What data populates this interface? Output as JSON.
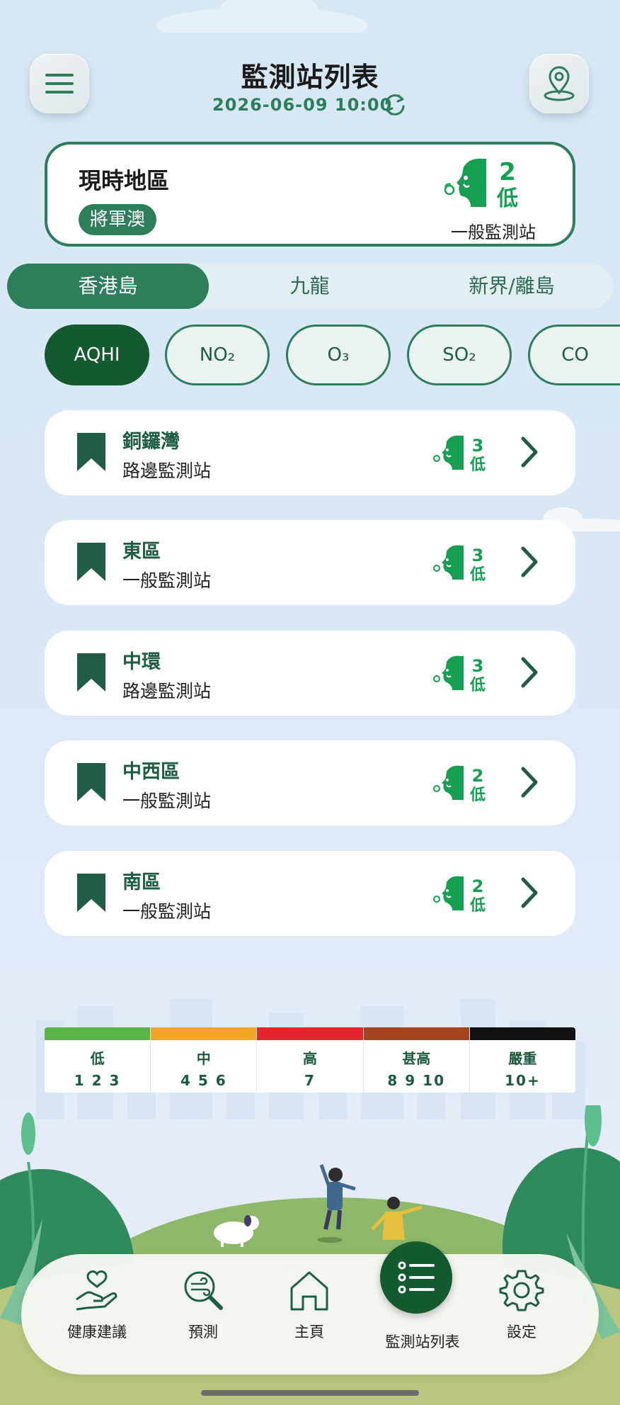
{
  "header": {
    "title": "監測站列表",
    "datetime": "2026-06-09 10:00"
  },
  "current_area": {
    "title": "現時地區",
    "district": "將軍澳",
    "aqhi_value": "2",
    "aqhi_level": "低",
    "station_type": "一般監測站"
  },
  "region_tabs": [
    {
      "label": "香港島",
      "active": true
    },
    {
      "label": "九龍",
      "active": false
    },
    {
      "label": "新界/離島",
      "active": false
    }
  ],
  "pollutant_chips": [
    {
      "label": "AQHI",
      "active": true
    },
    {
      "label": "NO₂",
      "active": false
    },
    {
      "label": "O₃",
      "active": false
    },
    {
      "label": "SO₂",
      "active": false
    },
    {
      "label": "CO",
      "active": false
    }
  ],
  "stations": [
    {
      "name": "銅鑼灣",
      "type": "路邊監測站",
      "aqhi": "3",
      "level": "低"
    },
    {
      "name": "東區",
      "type": "一般監測站",
      "aqhi": "3",
      "level": "低"
    },
    {
      "name": "中環",
      "type": "路邊監測站",
      "aqhi": "3",
      "level": "低"
    },
    {
      "name": "中西區",
      "type": "一般監測站",
      "aqhi": "2",
      "level": "低"
    },
    {
      "name": "南區",
      "type": "一般監測站",
      "aqhi": "2",
      "level": "低"
    }
  ],
  "scale": [
    {
      "label": "低",
      "range": "1 2 3",
      "color": "#5ab446"
    },
    {
      "label": "中",
      "range": "4 5 6",
      "color": "#f3a623"
    },
    {
      "label": "高",
      "range": "7",
      "color": "#e3262b"
    },
    {
      "label": "甚高",
      "range": "8 9 10",
      "color": "#a5441f"
    },
    {
      "label": "嚴重",
      "range": "10+",
      "color": "#111111"
    }
  ],
  "nav": {
    "health": "健康建議",
    "forecast": "預測",
    "home": "主頁",
    "stations": "監測站列表",
    "settings": "設定"
  },
  "colors": {
    "primary": "#2e7d5b",
    "dark": "#145a2f",
    "aqhi_low": "#14a050"
  },
  "icons": {
    "menu": "hamburger-icon",
    "location": "map-pin-icon",
    "refresh": "refresh-icon",
    "bookmark": "bookmark-icon",
    "chevron": "chevron-right-icon"
  }
}
